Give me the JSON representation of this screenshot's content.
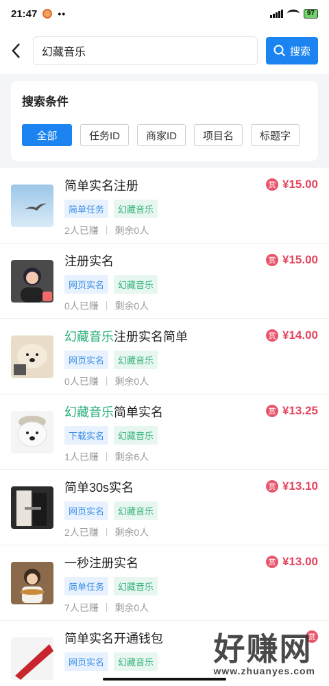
{
  "status_bar": {
    "time": "21:47",
    "dots": "••",
    "battery": "97"
  },
  "header": {
    "search_value": "幻藏音乐",
    "search_button": "搜索"
  },
  "filter": {
    "title": "搜索条件",
    "chips": [
      "全部",
      "任务ID",
      "商家ID",
      "项目名",
      "标题字"
    ]
  },
  "items": [
    {
      "title_hl": "",
      "title": "简单实名注册",
      "tags": [
        "简单任务",
        "幻藏音乐"
      ],
      "earned": "2人已赚",
      "remaining": "剩余0人",
      "reward_badge": "赏",
      "price": "¥15.00"
    },
    {
      "title_hl": "",
      "title": "注册实名",
      "tags": [
        "网页实名",
        "幻藏音乐"
      ],
      "earned": "0人已赚",
      "remaining": "剩余0人",
      "reward_badge": "赏",
      "price": "¥15.00"
    },
    {
      "title_hl": "幻藏音乐",
      "title": "注册实名简单",
      "tags": [
        "网页实名",
        "幻藏音乐"
      ],
      "earned": "0人已赚",
      "remaining": "剩余0人",
      "reward_badge": "赏",
      "price": "¥14.00"
    },
    {
      "title_hl": "幻藏音乐",
      "title": "简单实名",
      "tags": [
        "下载实名",
        "幻藏音乐"
      ],
      "earned": "1人已赚",
      "remaining": "剩余6人",
      "reward_badge": "赏",
      "price": "¥13.25"
    },
    {
      "title_hl": "",
      "title": "简单30s实名",
      "tags": [
        "网页实名",
        "幻藏音乐"
      ],
      "earned": "2人已赚",
      "remaining": "剩余0人",
      "reward_badge": "赏",
      "price": "¥13.10"
    },
    {
      "title_hl": "",
      "title": "一秒注册实名",
      "tags": [
        "简单任务",
        "幻藏音乐"
      ],
      "earned": "7人已赚",
      "remaining": "剩余0人",
      "reward_badge": "赏",
      "price": "¥13.00"
    },
    {
      "title_hl": "",
      "title": "简单实名开通钱包",
      "tags": [
        "网页实名",
        "幻藏音乐"
      ],
      "earned": "",
      "remaining": "",
      "reward_badge": "赏",
      "price": ""
    }
  ],
  "watermark": {
    "main": "好赚网",
    "sub": "www.zhuanyes.com"
  }
}
